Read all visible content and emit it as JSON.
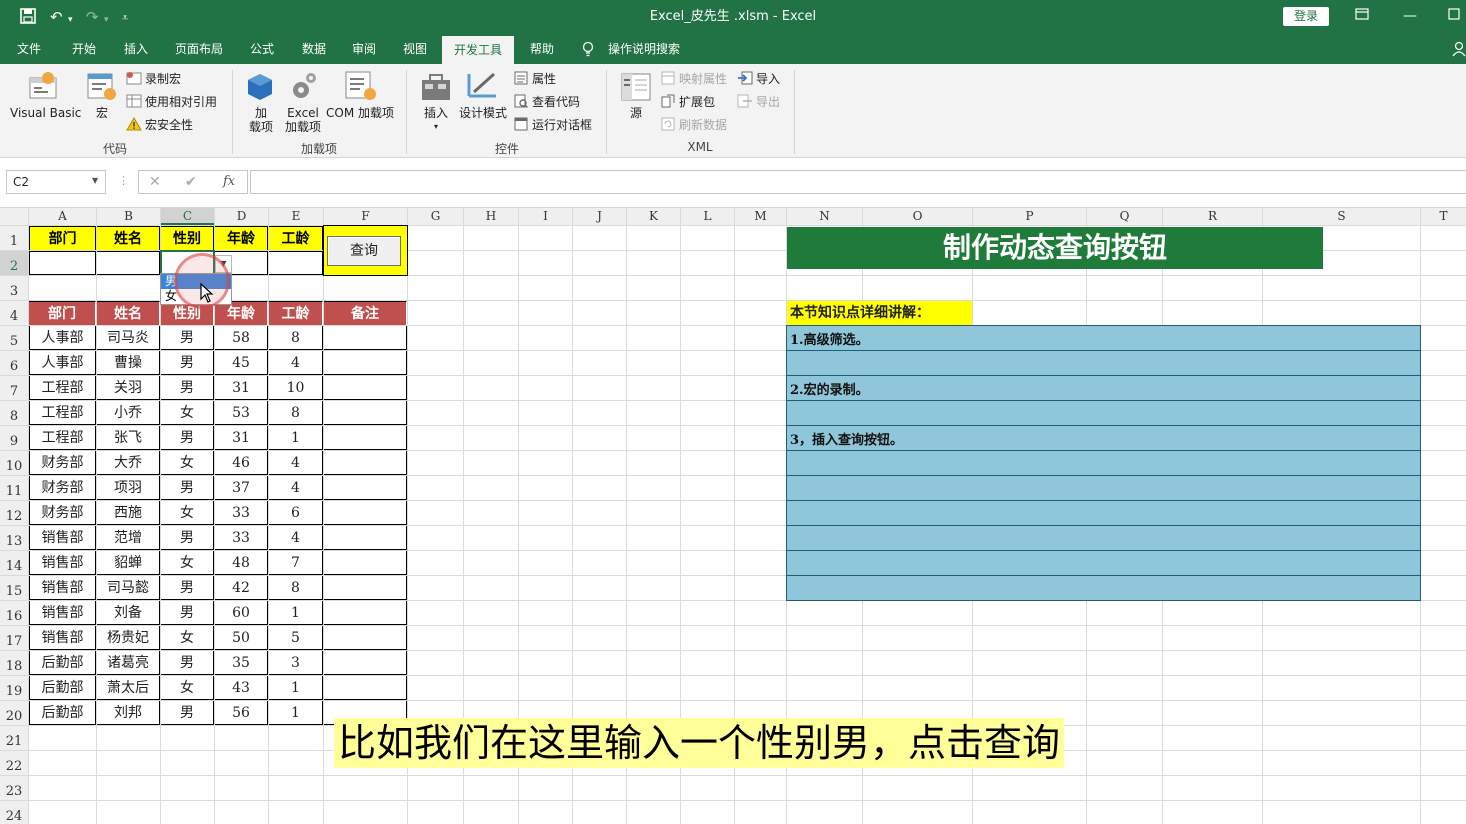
{
  "titlebar": {
    "title": "Excel_皮先生 .xlsm  -  Excel",
    "login": "登录"
  },
  "tabs": [
    "文件",
    "开始",
    "插入",
    "页面布局",
    "公式",
    "数据",
    "审阅",
    "视图",
    "开发工具",
    "帮助"
  ],
  "tell_me": "操作说明搜索",
  "ribbon": {
    "code": {
      "label": "代码",
      "visual_basic": "Visual Basic",
      "macros": "宏",
      "record_macro": "录制宏",
      "relative_ref": "使用相对引用",
      "macro_security": "宏安全性"
    },
    "addins": {
      "label": "加载项",
      "addins_line1": "加",
      "addins_line2": "载项",
      "excel_addins_line1": "Excel",
      "excel_addins_line2": "加载项",
      "com_addins": "COM 加载项"
    },
    "controls": {
      "label": "控件",
      "insert": "插入",
      "design_mode": "设计模式",
      "properties": "属性",
      "view_code": "查看代码",
      "run_dialog": "运行对话框"
    },
    "xml": {
      "label": "XML",
      "source": "源",
      "map_properties": "映射属性",
      "expansion_packs": "扩展包",
      "refresh_data": "刷新数据",
      "import": "导入",
      "export": "导出"
    }
  },
  "formula_bar": {
    "name_box": "C2",
    "fx": "fx",
    "formula": ""
  },
  "sheet": {
    "columns": [
      "A",
      "B",
      "C",
      "D",
      "E",
      "F",
      "G",
      "H",
      "I",
      "J",
      "K",
      "L",
      "M",
      "N",
      "O",
      "P",
      "Q",
      "R",
      "S",
      "T"
    ],
    "selected_column": "C",
    "rows": [
      "1",
      "2",
      "3",
      "4",
      "5",
      "6",
      "7",
      "8",
      "9",
      "10",
      "11",
      "12",
      "13",
      "14",
      "15",
      "16",
      "17",
      "18",
      "19",
      "20",
      "21",
      "22",
      "23",
      "24"
    ],
    "criteria_headers": [
      "部门",
      "姓名",
      "性别",
      "年龄",
      "工龄"
    ],
    "query_button": "查询",
    "dropdown_options": [
      "男",
      "女"
    ],
    "table_headers": [
      "部门",
      "姓名",
      "性别",
      "年龄",
      "工龄",
      "备注"
    ],
    "table_rows": [
      [
        "人事部",
        "司马炎",
        "男",
        "58",
        "8"
      ],
      [
        "人事部",
        "曹操",
        "男",
        "45",
        "4"
      ],
      [
        "工程部",
        "关羽",
        "男",
        "31",
        "10"
      ],
      [
        "工程部",
        "小乔",
        "女",
        "53",
        "8"
      ],
      [
        "工程部",
        "张飞",
        "男",
        "31",
        "1"
      ],
      [
        "财务部",
        "大乔",
        "女",
        "46",
        "4"
      ],
      [
        "财务部",
        "项羽",
        "男",
        "37",
        "4"
      ],
      [
        "财务部",
        "西施",
        "女",
        "33",
        "6"
      ],
      [
        "销售部",
        "范增",
        "男",
        "33",
        "4"
      ],
      [
        "销售部",
        "貂蝉",
        "女",
        "48",
        "7"
      ],
      [
        "销售部",
        "司马懿",
        "男",
        "42",
        "8"
      ],
      [
        "销售部",
        "刘备",
        "男",
        "60",
        "1"
      ],
      [
        "销售部",
        "杨贵妃",
        "女",
        "50",
        "5"
      ],
      [
        "后勤部",
        "诸葛亮",
        "男",
        "35",
        "3"
      ],
      [
        "后勤部",
        "萧太后",
        "女",
        "43",
        "1"
      ],
      [
        "后勤部",
        "刘邦",
        "男",
        "56",
        "1"
      ]
    ],
    "banner": "制作动态查询按钮",
    "knowledge_title": "本节知识点详细讲解：",
    "knowledge_points": [
      "1.高级筛选。",
      "2.宏的录制。",
      "3，插入查询按钮。"
    ]
  },
  "subtitle": "比如我们在这里输入一个性别男，点击查询",
  "colors": {
    "excel_green": "#217346",
    "banner_green": "#1e7b3a",
    "header_yellow": "#ffff00",
    "header_red": "#c0504d",
    "knowledge_blue": "#8fc6d9",
    "subtitle_bg": "#ffff99"
  }
}
